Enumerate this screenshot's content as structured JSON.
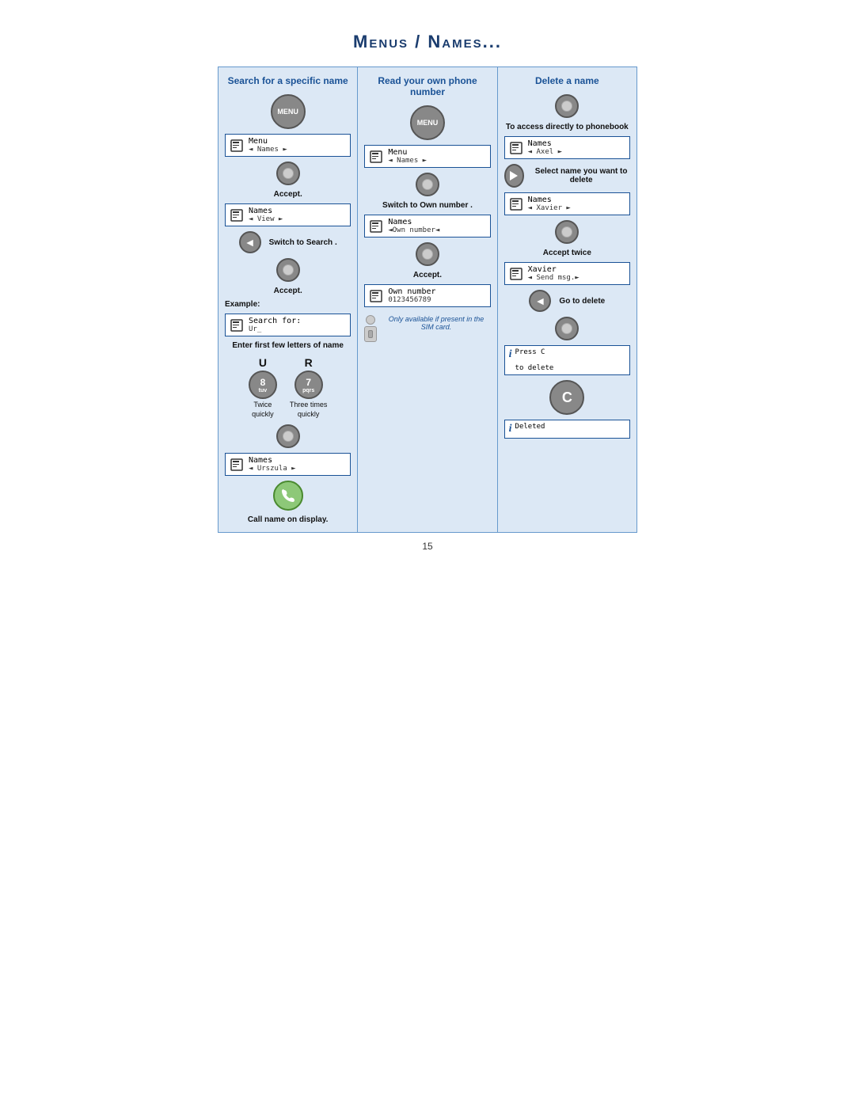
{
  "title": "Menus / Names...",
  "col1": {
    "header": "Search for a specific name",
    "step1_btn": "MENU",
    "screen1_line1": "Menu",
    "screen1_line2": "◄ Names ►",
    "label_accept": "Accept.",
    "screen2_line1": "Names",
    "screen2_line2": "◄ View ►",
    "label_switch": "Switch to Search .",
    "label_accept2": "Accept.",
    "label_example": "Example:",
    "screen3_line1": "Search for:",
    "screen3_line2": "Ur_",
    "label_enter": "Enter first few letters of name",
    "letter_u": "U",
    "btn_u_num": "8",
    "btn_u_letters": "tuv",
    "btn_u_times": "Twice",
    "btn_u_desc": "quickly",
    "letter_r": "R",
    "btn_r_num": "7",
    "btn_r_letters": "pqrs",
    "btn_r_times": "Three times",
    "btn_r_desc": "quickly",
    "screen4_line1": "Names",
    "screen4_line2": "◄ Urszula ►",
    "label_call": "Call name on display."
  },
  "col2": {
    "header": "Read your own phone number",
    "step1_btn": "MENU",
    "screen1_line1": "Menu",
    "screen1_line2": "◄ Names ►",
    "label_switch": "Switch to Own number .",
    "screen2_line1": "Names",
    "screen2_line2": "◄Own number◄",
    "label_accept": "Accept.",
    "screen3_line1": "Own number",
    "screen3_line2": "0123456789",
    "label_note": "Only available if present in the SIM card."
  },
  "col3": {
    "header": "Delete a name",
    "label_access": "To access directly to phonebook",
    "screen1_line1": "Names",
    "screen1_line2": "◄ Axel ►",
    "label_select": "Select name you want to delete",
    "screen2_line1": "Names",
    "screen2_line2": "◄ Xavier ►",
    "label_accept_twice": "Accept twice",
    "screen3_line1": "Xavier",
    "screen3_line2": "◄ Send msg.►",
    "label_go_delete": "Go to delete",
    "info1_line1": "Press C",
    "info1_line2": "to delete",
    "btn_c": "C",
    "info2_line1": "Deleted"
  },
  "page_number": "15"
}
